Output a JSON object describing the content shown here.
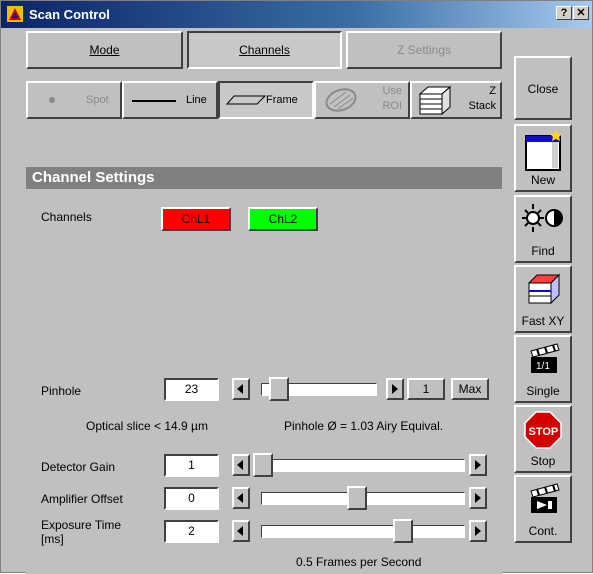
{
  "window": {
    "title": "Scan Control",
    "help_label": "?",
    "close_label": "✕"
  },
  "tabs": [
    {
      "label": "Mode",
      "enabled": true,
      "active": false
    },
    {
      "label": "Channels",
      "enabled": true,
      "active": true
    },
    {
      "label": "Z Settings",
      "enabled": false,
      "active": false
    }
  ],
  "scan_modes": {
    "spot": "Spot",
    "line": "Line",
    "frame": "Frame",
    "use_roi": [
      "Use",
      "ROI"
    ],
    "z_stack": [
      "Z",
      "Stack"
    ]
  },
  "section": {
    "title": "Channel Settings",
    "channels_label": "Channels",
    "channels": [
      {
        "name": "ChL1",
        "color": "#ff0000"
      },
      {
        "name": "ChL2",
        "color": "#00ff00"
      }
    ]
  },
  "pinhole": {
    "label": "Pinhole",
    "value": "23",
    "step_value": "1",
    "max_label": "Max",
    "optical_slice": "Optical slice < 14.9 µm",
    "airy": "Pinhole Ø = 1.03 Airy Equival."
  },
  "detector_gain": {
    "label": "Detector Gain",
    "value": "1",
    "level": 0.0
  },
  "amplifier_offset": {
    "label": "Amplifier Offset",
    "value": "0",
    "level": 0.45
  },
  "exposure_time": {
    "label1": "Exposure Time",
    "label2": "[ms]",
    "value": "2",
    "level": 0.7
  },
  "frame_rate": "0.5 Frames per Second",
  "side_buttons": {
    "close": "Close",
    "new": "New",
    "find": "Find",
    "fast_xy": "Fast XY",
    "single": "Single",
    "stop": "Stop",
    "cont": "Cont."
  },
  "colors": {
    "title_bar": "#0a246a",
    "panel": "#c0c0c0",
    "section_header": "#808080",
    "stop_red": "#d40000"
  }
}
